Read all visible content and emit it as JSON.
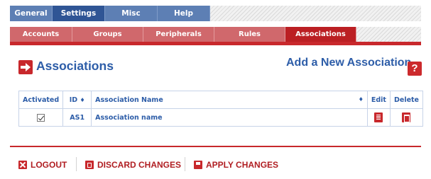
{
  "top_tabs": [
    {
      "label": "General",
      "active": false
    },
    {
      "label": "Settings",
      "active": true
    },
    {
      "label": "Misc",
      "active": false
    },
    {
      "label": "Help",
      "active": false
    }
  ],
  "sub_tabs": [
    {
      "label": "Accounts",
      "active": false
    },
    {
      "label": "Groups",
      "active": false
    },
    {
      "label": "Peripherals",
      "active": false
    },
    {
      "label": "Rules",
      "active": false
    },
    {
      "label": "Associations",
      "active": true
    }
  ],
  "heading": {
    "title": "Associations",
    "section_icon": "arrow-right-icon",
    "add_link": "Add a New Association",
    "help_icon": "help-icon",
    "help_glyph": "?"
  },
  "table": {
    "columns": {
      "activated": "Activated",
      "id": "ID",
      "name": "Association Name",
      "edit": "Edit",
      "delete": "Delete"
    },
    "rows": [
      {
        "activated": true,
        "id": "AS1",
        "name": "Association name"
      }
    ]
  },
  "footer": {
    "logout": "LOGOUT",
    "discard": "DISCARD CHANGES",
    "apply": "APPLY CHANGES"
  },
  "colors": {
    "primary_blue": "#2d5da8",
    "tab_blue": "#5d7fb4",
    "tab_blue_active": "#2f5595",
    "accent_red": "#c8282c",
    "subtab_red": "#d0686c"
  }
}
